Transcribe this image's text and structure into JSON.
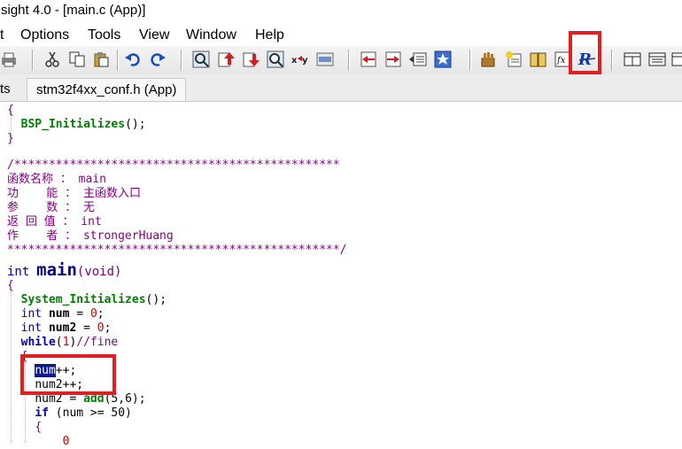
{
  "window": {
    "title": "sight 4.0 - [main.c (App)]"
  },
  "menu": [
    "t",
    "Options",
    "Tools",
    "View",
    "Window",
    "Help"
  ],
  "toolbar": {
    "icons": [
      "print-icon",
      "cut-icon",
      "copy-icon",
      "paste-icon",
      "undo-icon",
      "redo-icon",
      "search-icon",
      "jump-up-icon",
      "jump-down-icon",
      "lookup-icon",
      "replace-icon",
      "browse-icon",
      "prev-bookmark-icon",
      "next-bookmark-icon",
      "list-icon",
      "star-icon",
      "symbol-icon",
      "comment-icon",
      "books-icon",
      "fx-icon",
      "rebuild-icon",
      "layout-a-icon",
      "layout-b-icon",
      "layout-c-icon"
    ]
  },
  "tabs": [
    {
      "label": "ts"
    },
    {
      "label": "stm32f4xx_conf.h (App)"
    }
  ],
  "code": {
    "l1": "{",
    "l2_fn": "BSP_Initializes",
    "l2_rest": "();",
    "l3": "}",
    "c1": "/***********************************************",
    "c2": "函数名称 ： main",
    "c3": "功    能 ： 主函数入口",
    "c4": "参    数 ： 无",
    "c5": "返 回 值 ： int",
    "c6": "作    者 ： strongerHuang",
    "c7": "************************************************/",
    "m_kw": "int",
    "m_name": "main",
    "m_args": "(void)",
    "m_open": "{",
    "s1_fn": "System_Initializes",
    "s1_rest": "();",
    "d1_kw": "int",
    "d1_var": "num",
    "d1_eq": " = ",
    "d1_val": "0",
    "d1_semi": ";",
    "d2_kw": "int",
    "d2_var": "num2",
    "d2_eq": " = ",
    "d2_val": "0",
    "d2_semi": ";",
    "w_kw": "while",
    "w_open": "(",
    "w_val": "1",
    "w_close": ")",
    "w_cm": "//fine",
    "w_brace": "{",
    "i1_sel": "num",
    "i1_rest": "++;",
    "i2": "num2++;",
    "a_lhs": "num2 = ",
    "a_fn": "add",
    "a_args": "(5,6);",
    "if_kw": "if",
    "if_cond": " (num >= 50)",
    "if_brace": "{",
    "last": "        0"
  }
}
